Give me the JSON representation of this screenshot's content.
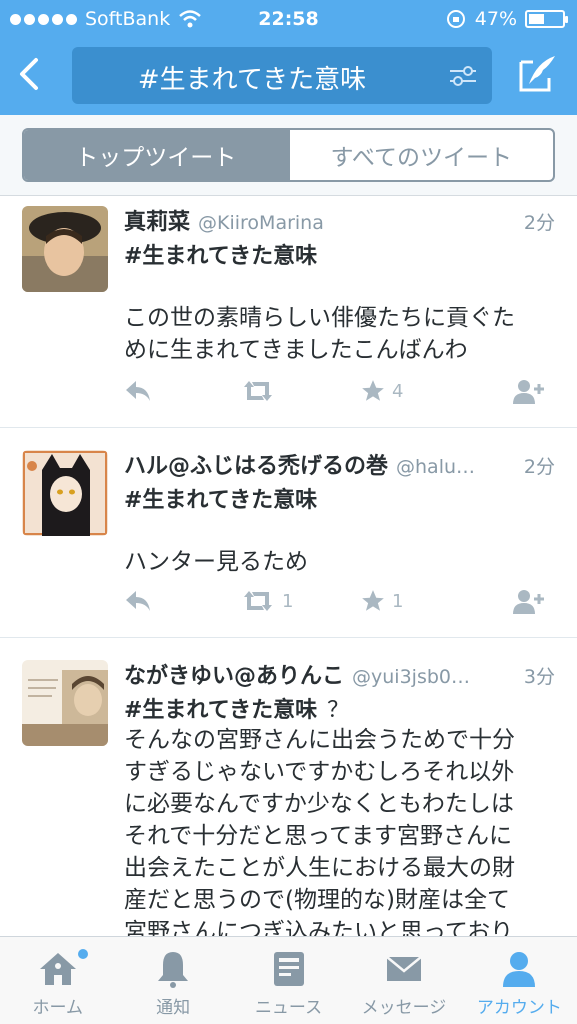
{
  "status_bar": {
    "carrier": "SoftBank",
    "time": "22:58",
    "battery": "47%",
    "battery_level": 0.47
  },
  "nav": {
    "search_query": "#生まれてきた意味"
  },
  "segments": {
    "top": "トップツイート",
    "all": "すべてのツイート"
  },
  "tweets": [
    {
      "name": "真莉菜",
      "handle": "@KiiroMarina",
      "time": "2分",
      "hashtag": "#生まれてきた意味",
      "hashtag_extra": "",
      "lines": [
        "この世の素晴らしい俳優たちに貢ぐた",
        "めに生まれてきましたこんばんわ"
      ],
      "retweets": "",
      "favorites": "4"
    },
    {
      "name": "ハル@ふじはる禿げるの巻",
      "handle": "@halu…",
      "time": "2分",
      "hashtag": "#生まれてきた意味",
      "hashtag_extra": "",
      "lines": [
        "ハンター見るため"
      ],
      "retweets": "1",
      "favorites": "1"
    },
    {
      "name": "ながきゆい@ありんこ",
      "handle": "@yui3jsb0…",
      "time": "3分",
      "hashtag": "#生まれてきた意味",
      "hashtag_extra": "？",
      "lines": [
        "そんなの宮野さんに出会うためで十分",
        "すぎるじゃないですかむしろそれ以外",
        "に必要なんですか少なくともわたしは",
        "それで十分だと思ってます宮野さんに",
        "出会えたことが人生における最大の財",
        "産だと思うので(物理的な)財産は全て",
        "宮野さんにつぎ込みたいと思っており"
      ]
    }
  ],
  "tabbar": {
    "home": "ホーム",
    "notifications": "通知",
    "news": "ニュース",
    "messages": "メッセージ",
    "account": "アカウント"
  },
  "colors": {
    "brand": "#55acee",
    "icon_gray": "#aab8c2",
    "text": "#292f33",
    "secondary": "#8899a6"
  }
}
